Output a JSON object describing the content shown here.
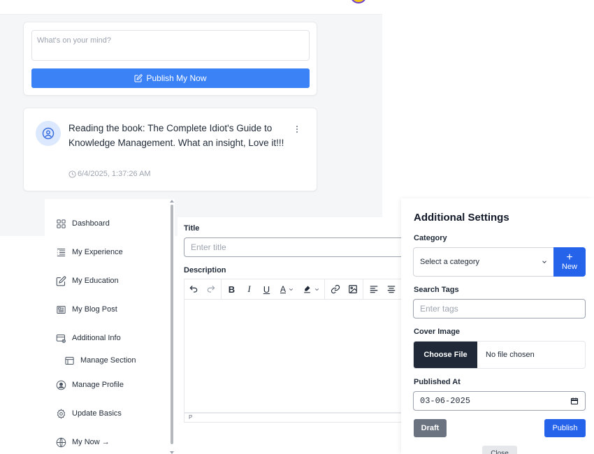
{
  "composer": {
    "placeholder": "What's on your mind?",
    "publish_label": "Publish My Now"
  },
  "post": {
    "text": "Reading the book: The Complete Idiot's Guide to Knowledge Management. What an insight, Love it!!!",
    "timestamp": "6/4/2025, 1:37:26 AM"
  },
  "sidebar": {
    "items": [
      {
        "label": "Dashboard",
        "icon": "grid-icon"
      },
      {
        "label": "My Experience",
        "icon": "list-icon"
      },
      {
        "label": "My Education",
        "icon": "edit-icon"
      },
      {
        "label": "My Blog Post",
        "icon": "newspaper-icon"
      },
      {
        "label": "Additional Info",
        "icon": "card-settings-icon"
      },
      {
        "label": "Manage Section",
        "icon": "window-icon"
      },
      {
        "label": "Manage Profile",
        "icon": "user-circle-icon"
      },
      {
        "label": "Update Basics",
        "icon": "gear-icon"
      },
      {
        "label": "My Now →",
        "icon": "globe-icon"
      }
    ]
  },
  "editor": {
    "title_label": "Title",
    "title_placeholder": "Enter title",
    "description_label": "Description",
    "status_path": "P"
  },
  "settings": {
    "heading": "Additional Settings",
    "category_label": "Category",
    "category_value": "Select a category",
    "new_label": "New",
    "tags_label": "Search Tags",
    "tags_placeholder": "Enter tags",
    "cover_label": "Cover Image",
    "choose_file_label": "Choose File",
    "no_file_label": "No file chosen",
    "published_label": "Published At",
    "published_value": "03-06-2025",
    "draft_label": "Draft",
    "publish_label": "Publish",
    "close_label": "Close"
  },
  "colors": {
    "primary": "#3b82f6",
    "primary_dark": "#2563eb",
    "dark": "#1f2937",
    "muted": "#6b7280"
  }
}
